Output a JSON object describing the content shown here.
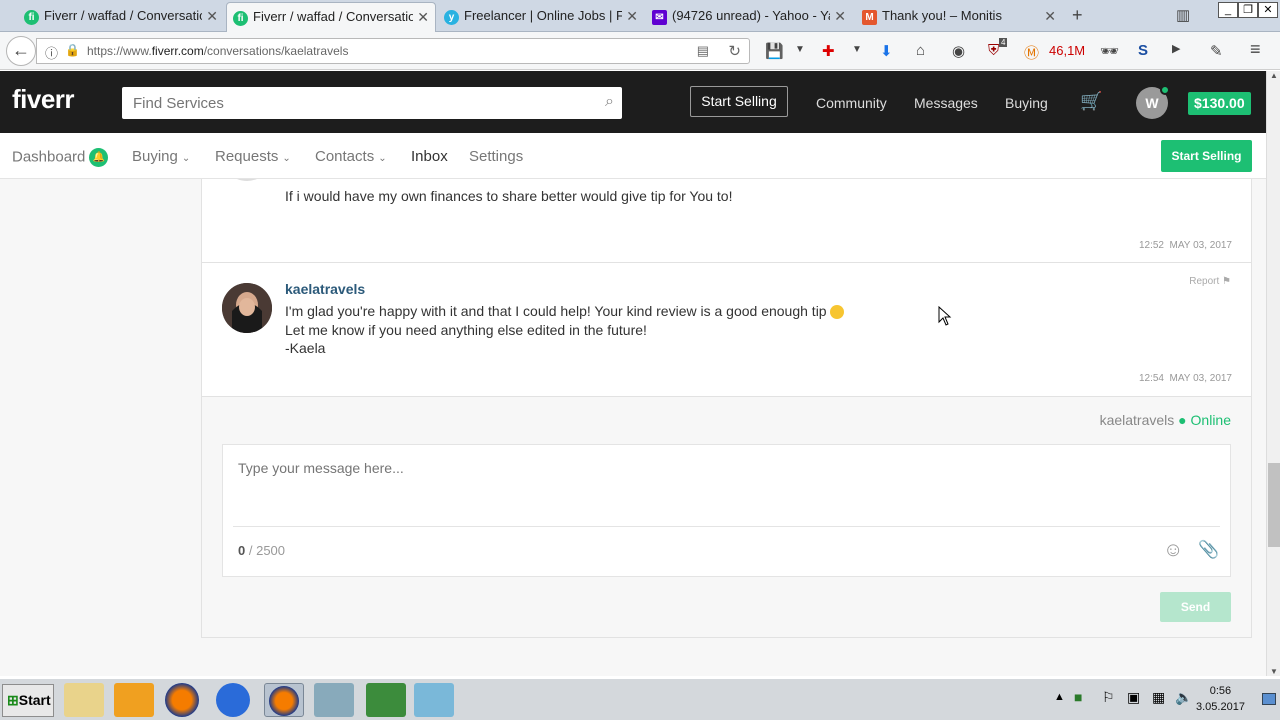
{
  "browser": {
    "tabs": [
      {
        "label": "Fiverr / waffad / Conversations",
        "icon": "fiverr-favicon",
        "active": false
      },
      {
        "label": "Fiverr / waffad / Conversations",
        "icon": "fiverr-favicon",
        "active": true
      },
      {
        "label": "Freelancer | Online Jobs | Freelance",
        "icon": "freelancer-favicon",
        "active": false
      },
      {
        "label": "(94726 unread) - Yahoo - Yahoo Mail",
        "icon": "yahoo-favicon",
        "active": false
      },
      {
        "label": "Thank you! – Monitis",
        "icon": "monitis-favicon",
        "active": false
      }
    ],
    "url_prefix": "https://www.",
    "url_domain": "fiverr.com",
    "url_path": "/conversations/kaelatravels",
    "badge_count": "4",
    "memory": "46,1M"
  },
  "header": {
    "logo": "fiverr",
    "search_placeholder": "Find Services",
    "start_selling": "Start Selling",
    "community": "Community",
    "messages": "Messages",
    "buying": "Buying",
    "avatar_letter": "W",
    "balance": "$130.00"
  },
  "subnav": {
    "dashboard": "Dashboard",
    "buying": "Buying",
    "requests": "Requests",
    "contacts": "Contacts",
    "inbox": "Inbox",
    "settings": "Settings",
    "start_selling": "Start Selling"
  },
  "conversation": {
    "messages": [
      {
        "text": "If i would have my own finances to share better would give tip for You to!",
        "time": "12:52",
        "date": "MAY 03, 2017"
      },
      {
        "user": "kaelatravels",
        "report": "Report",
        "line1": "I'm glad you're happy with it and that I could help! Your kind review is a good enough tip",
        "line2": "Let me know if you need anything else edited in the future!",
        "line3": "-Kaela",
        "time": "12:54",
        "date": "MAY 03, 2017"
      }
    ],
    "recipient": "kaelatravels",
    "status": "Online",
    "compose_placeholder": "Type your message here...",
    "char_count": "0",
    "char_limit": "/ 2500",
    "send": "Send"
  },
  "taskbar": {
    "start": "Start",
    "time": "0:56",
    "date": "3.05.2017"
  },
  "colors": {
    "fiverr_green": "#1dbf73",
    "header_dark": "#1d1d1d",
    "username_blue": "#2c5a7a"
  }
}
